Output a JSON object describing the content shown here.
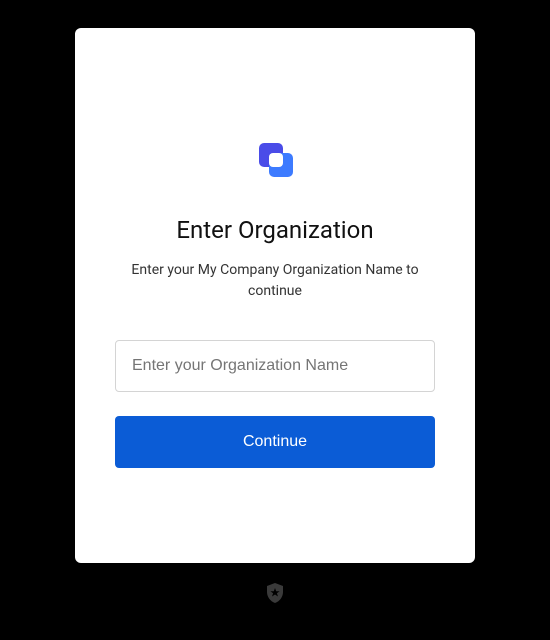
{
  "card": {
    "title": "Enter Organization",
    "subtitle": "Enter your My Company Organization Name to continue",
    "org_input_placeholder": "Enter your Organization Name",
    "continue_label": "Continue"
  },
  "colors": {
    "primary_button": "#0B5CD6",
    "logo_blue": "#3B5BFF",
    "logo_lightblue": "#3D7BFF"
  }
}
